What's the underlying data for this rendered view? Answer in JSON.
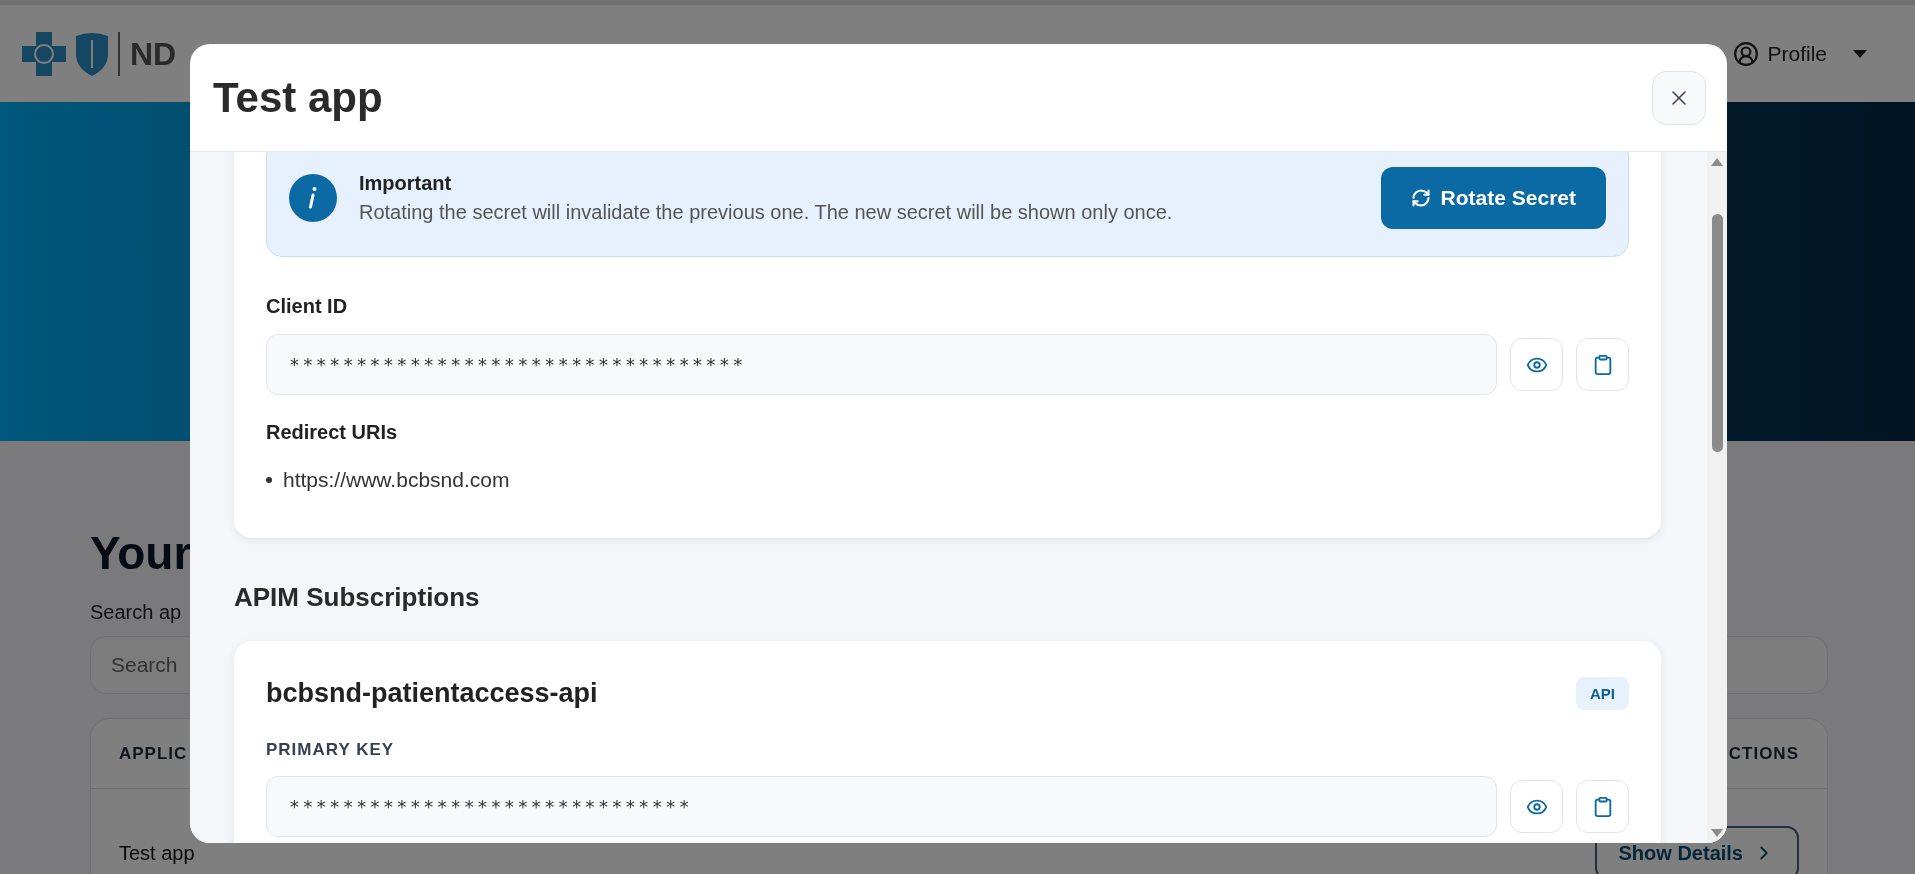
{
  "header": {
    "logo_text": "ND",
    "profile": "Profile"
  },
  "page": {
    "heading": "Your",
    "search_label": "Search ap",
    "search": {
      "placeholder": "Search"
    },
    "table": {
      "columns": [
        "APPLIC",
        "CTIONS"
      ],
      "rows": [
        {
          "name": "Test app",
          "action": "Show Details"
        }
      ]
    }
  },
  "modal": {
    "title": "Test app",
    "notice": {
      "title": "Important",
      "text": "Rotating the secret will invalidate the previous one. The new secret will be shown only once.",
      "button": "Rotate Secret"
    },
    "client_id": {
      "label": "Client ID",
      "value": "**********************************"
    },
    "redirect_uris": {
      "label": "Redirect URIs",
      "items": [
        "https://www.bcbsnd.com"
      ]
    },
    "subscriptions_title": "APIM Subscriptions",
    "subscriptions": [
      {
        "name": "bcbsnd-patientaccess-api",
        "badge": "API",
        "key_label": "PRIMARY KEY",
        "key_value": "******************************"
      }
    ]
  }
}
